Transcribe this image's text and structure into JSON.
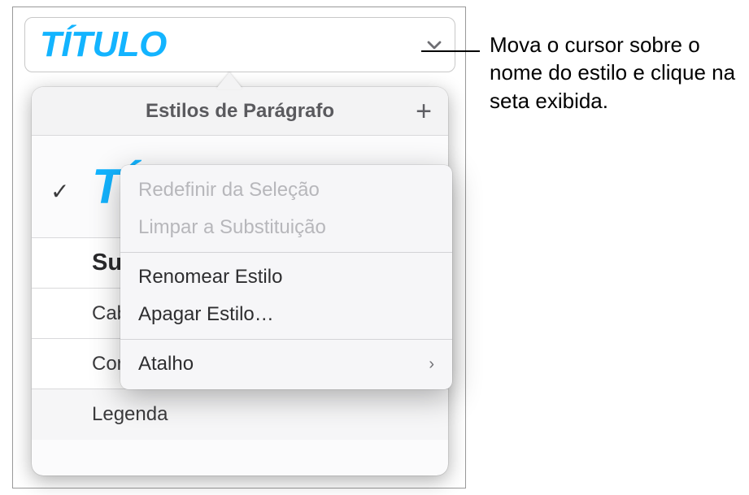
{
  "style_bar": {
    "title": "TÍTULO"
  },
  "popover": {
    "header": "Estilos de Parágrafo",
    "rows": {
      "titulo": "TÍTULO",
      "subtitulo": "Sul",
      "cabecalho": "Cab",
      "corpo": "Corp",
      "legenda": "Legenda"
    }
  },
  "context_menu": {
    "redefine": "Redefinir da Seleção",
    "clear": "Limpar a Substituição",
    "rename": "Renomear Estilo",
    "delete": "Apagar Estilo…",
    "shortcut": "Atalho"
  },
  "callout": "Mova o cursor sobre o nome do estilo e clique na seta exibida.",
  "glyphs": {
    "check": "✓",
    "chevron_right": "›"
  }
}
